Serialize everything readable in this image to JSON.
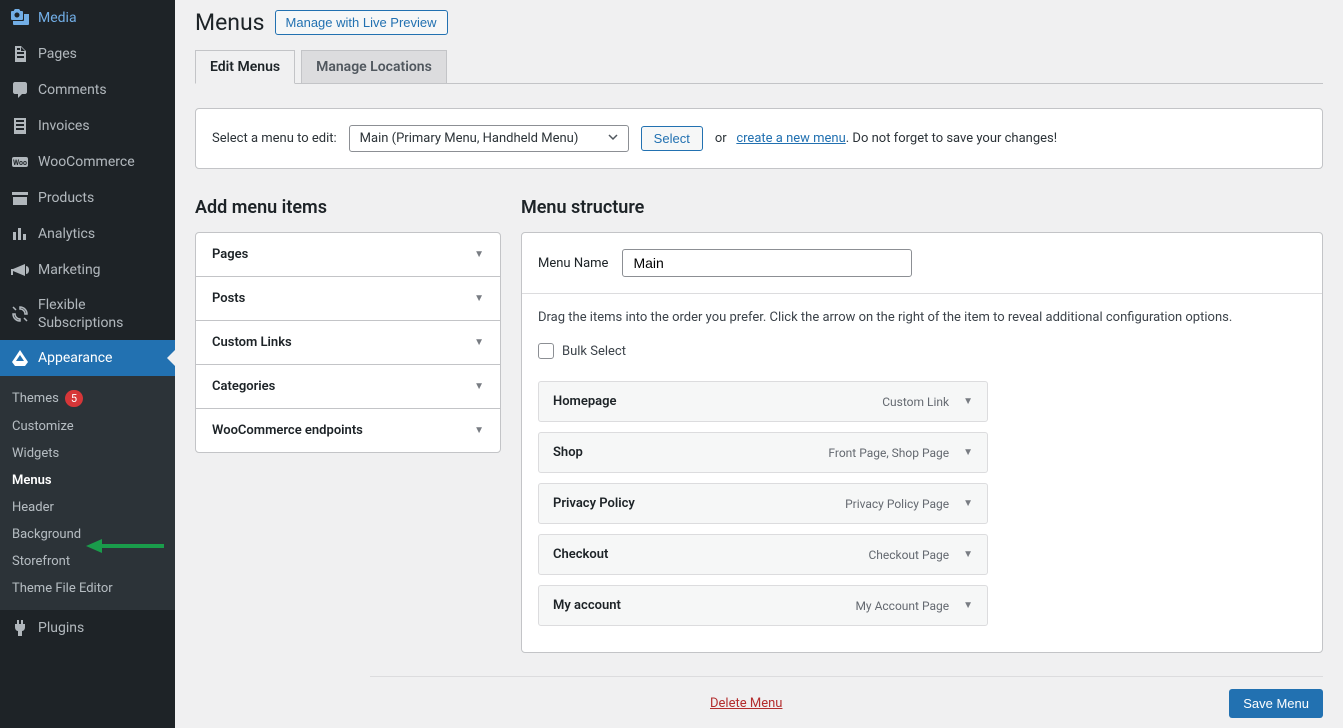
{
  "page": {
    "title": "Menus",
    "live_preview": "Manage with Live Preview"
  },
  "tabs": {
    "edit_menus": "Edit Menus",
    "manage_locations": "Manage Locations"
  },
  "edit_bar": {
    "label": "Select a menu to edit:",
    "selected": "Main (Primary Menu, Handheld Menu)",
    "select_btn": "Select",
    "or": "or",
    "create_link": "create a new menu",
    "note": ". Do not forget to save your changes!"
  },
  "add_items": {
    "title": "Add menu items",
    "groups": [
      "Pages",
      "Posts",
      "Custom Links",
      "Categories",
      "WooCommerce endpoints"
    ]
  },
  "structure": {
    "title": "Menu structure",
    "name_label": "Menu Name",
    "name_value": "Main",
    "instructions": "Drag the items into the order you prefer. Click the arrow on the right of the item to reveal additional configuration options.",
    "bulk_select": "Bulk Select",
    "items": [
      {
        "title": "Homepage",
        "type": "Custom Link"
      },
      {
        "title": "Shop",
        "type": "Front Page, Shop Page"
      },
      {
        "title": "Privacy Policy",
        "type": "Privacy Policy Page"
      },
      {
        "title": "Checkout",
        "type": "Checkout Page"
      },
      {
        "title": "My account",
        "type": "My Account Page"
      }
    ]
  },
  "footer": {
    "delete": "Delete Menu",
    "save": "Save Menu"
  },
  "sidebar": {
    "items": [
      {
        "label": "Media",
        "icon": "media"
      },
      {
        "label": "Pages",
        "icon": "pages"
      },
      {
        "label": "Comments",
        "icon": "comments"
      },
      {
        "label": "Invoices",
        "icon": "invoices"
      },
      {
        "label": "WooCommerce",
        "icon": "woo"
      },
      {
        "label": "Products",
        "icon": "products"
      },
      {
        "label": "Analytics",
        "icon": "analytics"
      },
      {
        "label": "Marketing",
        "icon": "marketing"
      },
      {
        "label": "Flexible Subscriptions",
        "icon": "subs"
      },
      {
        "label": "Appearance",
        "icon": "appearance",
        "active": true
      },
      {
        "label": "Plugins",
        "icon": "plugins"
      }
    ],
    "appearance_sub": [
      {
        "label": "Themes",
        "badge": "5"
      },
      {
        "label": "Customize"
      },
      {
        "label": "Widgets"
      },
      {
        "label": "Menus",
        "current": true
      },
      {
        "label": "Header"
      },
      {
        "label": "Background"
      },
      {
        "label": "Storefront"
      },
      {
        "label": "Theme File Editor"
      }
    ]
  }
}
